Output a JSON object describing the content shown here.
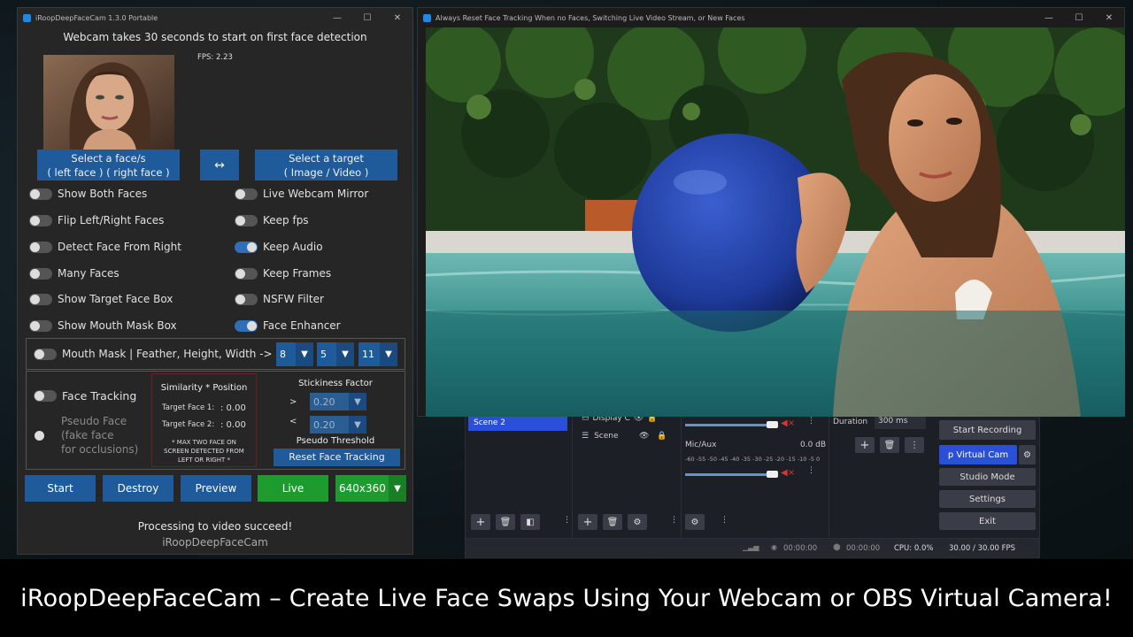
{
  "app": {
    "title": "iRoopDeepFaceCam 1.3.0 Portable",
    "notice": "Webcam takes 30 seconds to start on first face detection",
    "fps": "FPS: 2.23",
    "select_face_line1": "Select a face/s",
    "select_face_line2": "( left face ) ( right face )",
    "swap_label": "↔",
    "select_target_line1": "Select a target",
    "select_target_line2": "( Image / Video )",
    "toggles_left": [
      {
        "label": "Show Both Faces",
        "on": false
      },
      {
        "label": "Flip Left/Right Faces",
        "on": false
      },
      {
        "label": "Detect Face From Right",
        "on": false
      },
      {
        "label": "Many Faces",
        "on": false
      },
      {
        "label": "Show Target Face Box",
        "on": false
      },
      {
        "label": "Show Mouth Mask Box",
        "on": false
      }
    ],
    "toggles_right": [
      {
        "label": "Live Webcam Mirror",
        "on": false
      },
      {
        "label": "Keep fps",
        "on": false
      },
      {
        "label": "Keep Audio",
        "on": true
      },
      {
        "label": "Keep Frames",
        "on": false
      },
      {
        "label": "NSFW Filter",
        "on": false
      },
      {
        "label": "Face Enhancer",
        "on": true
      }
    ],
    "mouth_mask_label": "Mouth Mask | Feather, Height, Width ->",
    "mouth_feather": "8",
    "mouth_height": "5",
    "mouth_width": "11",
    "face_tracking_label": "Face Tracking",
    "pseudo_face_line1": "Pseudo Face",
    "pseudo_face_line2": "(fake face",
    "pseudo_face_line3": "for occlusions)",
    "similarity_title": "Similarity * Position",
    "target_face1_label": "Target Face 1:",
    "target_face1_value": ": 0.00",
    "target_face2_label": "Target Face 2:",
    "target_face2_value": ": 0.00",
    "max_note_line1": "* MAX TWO FACE ON",
    "max_note_line2": "SCREEN DETECTED FROM",
    "max_note_line3": "LEFT OR RIGHT *",
    "stickiness_title": "Stickiness Factor",
    "gt": ">",
    "lt": "<",
    "stickiness_value": "0.20",
    "pseudo_threshold_value": "0.20",
    "pseudo_threshold_label": "Pseudo Threshold",
    "reset_tracking": "Reset Face Tracking",
    "btn_start": "Start",
    "btn_destroy": "Destroy",
    "btn_preview": "Preview",
    "btn_live": "Live",
    "resolution": "640x360",
    "status": "Processing to video succeed!",
    "footer": "iRoopDeepFaceCam"
  },
  "video_window": {
    "title": "Always Reset Face Tracking When no Faces, Switching Live Video Stream, or New Faces"
  },
  "obs": {
    "scene_item": "Scene 2",
    "source_display": "Display C",
    "source_scene": "Scene",
    "mic_label": "Mic/Aux",
    "mic_db": "0.0 dB",
    "meter_ticks": "-60 -55 -50 -45 -40 -35 -30 -25 -20 -15 -10 -5 0",
    "duration_label": "Duration",
    "duration_value": "300 ms",
    "start_recording": "Start Recording",
    "virtual_cam": "p Virtual Cam",
    "studio_mode": "Studio Mode",
    "settings": "Settings",
    "exit": "Exit",
    "time1": "00:00:00",
    "time2": "00:00:00",
    "cpu": "CPU: 0.0%",
    "fps": "30.00 / 30.00 FPS"
  },
  "caption": "iRoopDeepFaceCam – Create Live Face Swaps Using Your Webcam or OBS Virtual Camera!",
  "colors": {
    "accent": "#1f5a9a",
    "live": "#1e9b2e",
    "toggle_on": "#2f6fb8"
  }
}
